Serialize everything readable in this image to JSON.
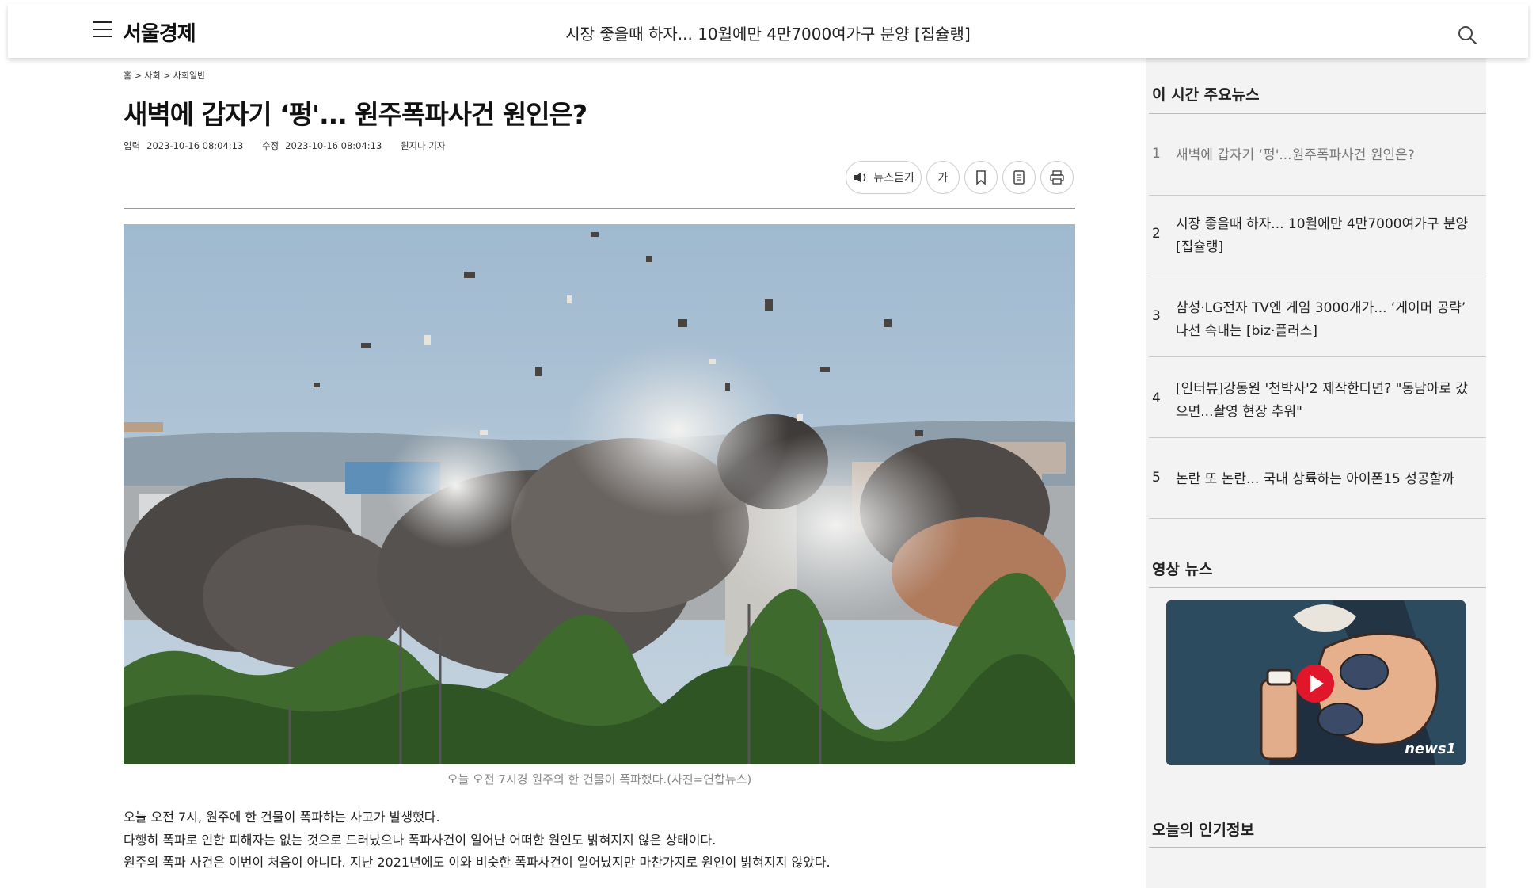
{
  "header": {
    "logo": "서울경제",
    "headline": "시장 좋을때 하자... 10월에만 4만7000여가구 분양 [집슐랭]"
  },
  "article": {
    "breadcrumb": "홈 > 사회 > 사회일반",
    "title": "새벽에 갑자기 ‘펑'... 원주폭파사건 원인은?",
    "meta": {
      "input_label": "입력",
      "input_time": "2023-10-16 08:04:13",
      "edit_label": "수정",
      "edit_time": "2023-10-16 08:04:13",
      "reporter": "원지나 기자"
    },
    "tools": {
      "listen_label": "뉴스듣기",
      "font_label": "가"
    },
    "caption": "오늘 오전 7시경 원주의 한 건물이 폭파했다.(사진=연합뉴스)",
    "paragraphs": [
      "오늘 오전 7시, 원주에 한 건물이 폭파하는 사고가 발생했다.",
      "다행히 폭파로 인한 피해자는 없는 것으로 드러났으나 폭파사건이 일어난 어떠한 원인도 밝혀지지 않은 상태이다.",
      "원주의 폭파 사건은 이번이 처음이 아니다. 지난 2021년에도 이와 비슷한 폭파사건이 일어났지만 마찬가지로 원인이 밝혀지지 않았다."
    ]
  },
  "sidebar": {
    "top_news_title": "이 시간 주요뉴스",
    "top_news": [
      {
        "num": "1",
        "text": "새벽에 갑자기 ‘펑'...원주폭파사건 원인은?"
      },
      {
        "num": "2",
        "text": "시장 좋을때 하자... 10월에만 4만7000여가구 분양 [집슐랭]"
      },
      {
        "num": "3",
        "text": "삼성·LG전자 TV엔 게임 3000개가... ‘게이머 공략’ 나선 속내는 [biz·플러스]"
      },
      {
        "num": "4",
        "text": "[인터뷰]강동원 '천박사'2 제작한다면? \"동남아로 갔으면...촬영 현장 추워\""
      },
      {
        "num": "5",
        "text": "논란 또 논란... 국내 상륙하는 아이폰15 성공할까"
      }
    ],
    "video_title": "영상 뉴스",
    "video_brand": "news1",
    "popular_title": "오늘의 인기정보"
  },
  "colors": {
    "play_button": "#e0162b",
    "sidebar_bg": "#f3f3f3"
  }
}
